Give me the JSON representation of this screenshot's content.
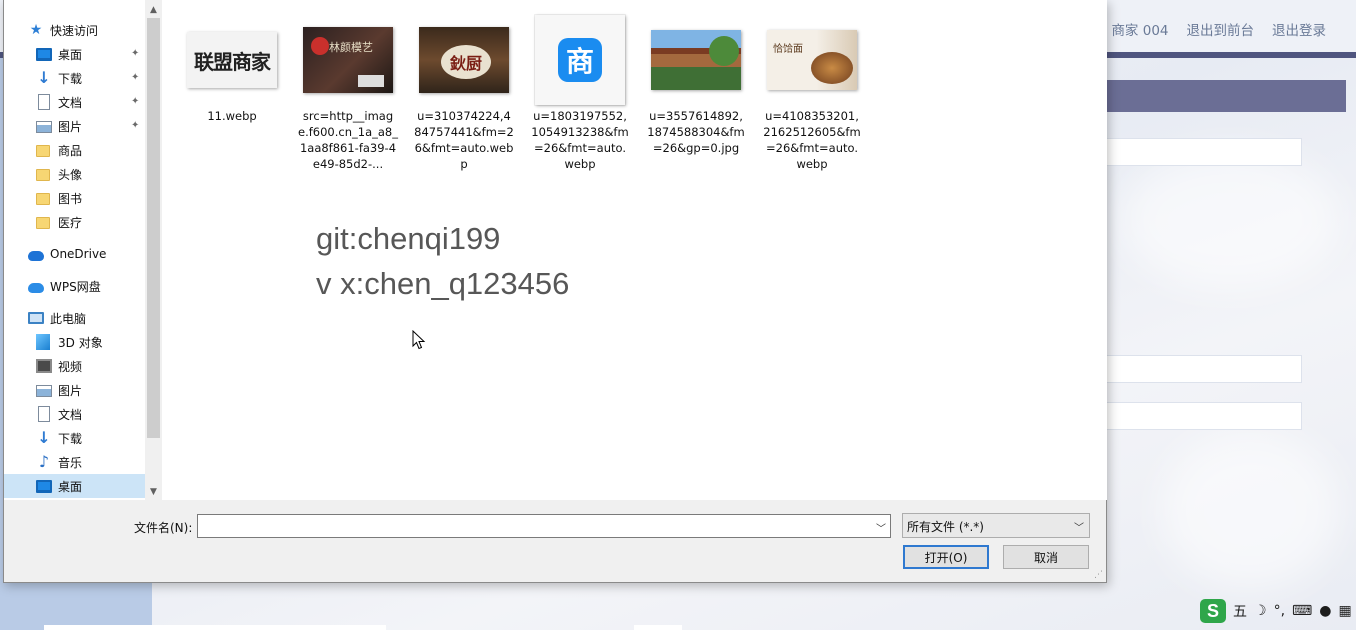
{
  "background_page": {
    "nav": [
      "商家 004",
      "退出到前台",
      "退出登录"
    ]
  },
  "dialog": {
    "nav_pane": {
      "items": [
        {
          "label": "快速访问",
          "icon": "star-icon",
          "pinned": false
        },
        {
          "label": "桌面",
          "icon": "desktop-icon",
          "pinned": true
        },
        {
          "label": "下载",
          "icon": "download-icon",
          "pinned": true
        },
        {
          "label": "文档",
          "icon": "document-icon",
          "pinned": true
        },
        {
          "label": "图片",
          "icon": "pictures-icon",
          "pinned": true
        },
        {
          "label": "商品",
          "icon": "folder-icon",
          "pinned": false
        },
        {
          "label": "头像",
          "icon": "folder-icon",
          "pinned": false
        },
        {
          "label": "图书",
          "icon": "folder-icon",
          "pinned": false
        },
        {
          "label": "医疗",
          "icon": "folder-icon",
          "pinned": false
        },
        {
          "label": "OneDrive",
          "icon": "onedrive-cloud-icon",
          "pinned": false
        },
        {
          "label": "WPS网盘",
          "icon": "wps-cloud-icon",
          "pinned": false
        },
        {
          "label": "此电脑",
          "icon": "this-pc-icon",
          "pinned": false
        },
        {
          "label": "3D 对象",
          "icon": "3d-objects-icon",
          "pinned": false
        },
        {
          "label": "视频",
          "icon": "videos-icon",
          "pinned": false
        },
        {
          "label": "图片",
          "icon": "pictures-icon",
          "pinned": false
        },
        {
          "label": "文档",
          "icon": "document-icon",
          "pinned": false
        },
        {
          "label": "下载",
          "icon": "download-icon",
          "pinned": false
        },
        {
          "label": "音乐",
          "icon": "music-icon",
          "pinned": false
        },
        {
          "label": "桌面",
          "icon": "desktop-icon",
          "pinned": false,
          "selected": true
        }
      ]
    },
    "files": [
      {
        "name": "11.webp",
        "thumb_text": "联盟商家"
      },
      {
        "name": "src=http__image.f600.cn_1a_a8_1aa8f861-fa39-4e49-85d2-...",
        "thumb_text": "林颜模艺"
      },
      {
        "name": "u=310374224,484757441&fm=26&fmt=auto.webp",
        "thumb_text": "鈥厨"
      },
      {
        "name": "u=1803197552,1054913238&fm=26&fmt=auto.webp",
        "thumb_text": "商"
      },
      {
        "name": "u=3557614892,1874588304&fm=26&gp=0.jpg",
        "thumb_text": ""
      },
      {
        "name": "u=4108353201,2162512605&fm=26&fmt=auto.webp",
        "thumb_text": "恰饸面"
      }
    ],
    "watermark_lines": [
      "git:chenqi199",
      "v x:chen_q123456"
    ],
    "filename_label": "文件名(N):",
    "filename_value": "",
    "filter_selected": "所有文件 (*.*)",
    "open_button": "打开(O)",
    "cancel_button": "取消"
  },
  "ime_toolbar": {
    "mode": "五",
    "icons": [
      "sogou-s-icon",
      "moon-icon",
      "punctuation-icon",
      "keyboard-icon",
      "user-icon",
      "grid-icon"
    ]
  }
}
